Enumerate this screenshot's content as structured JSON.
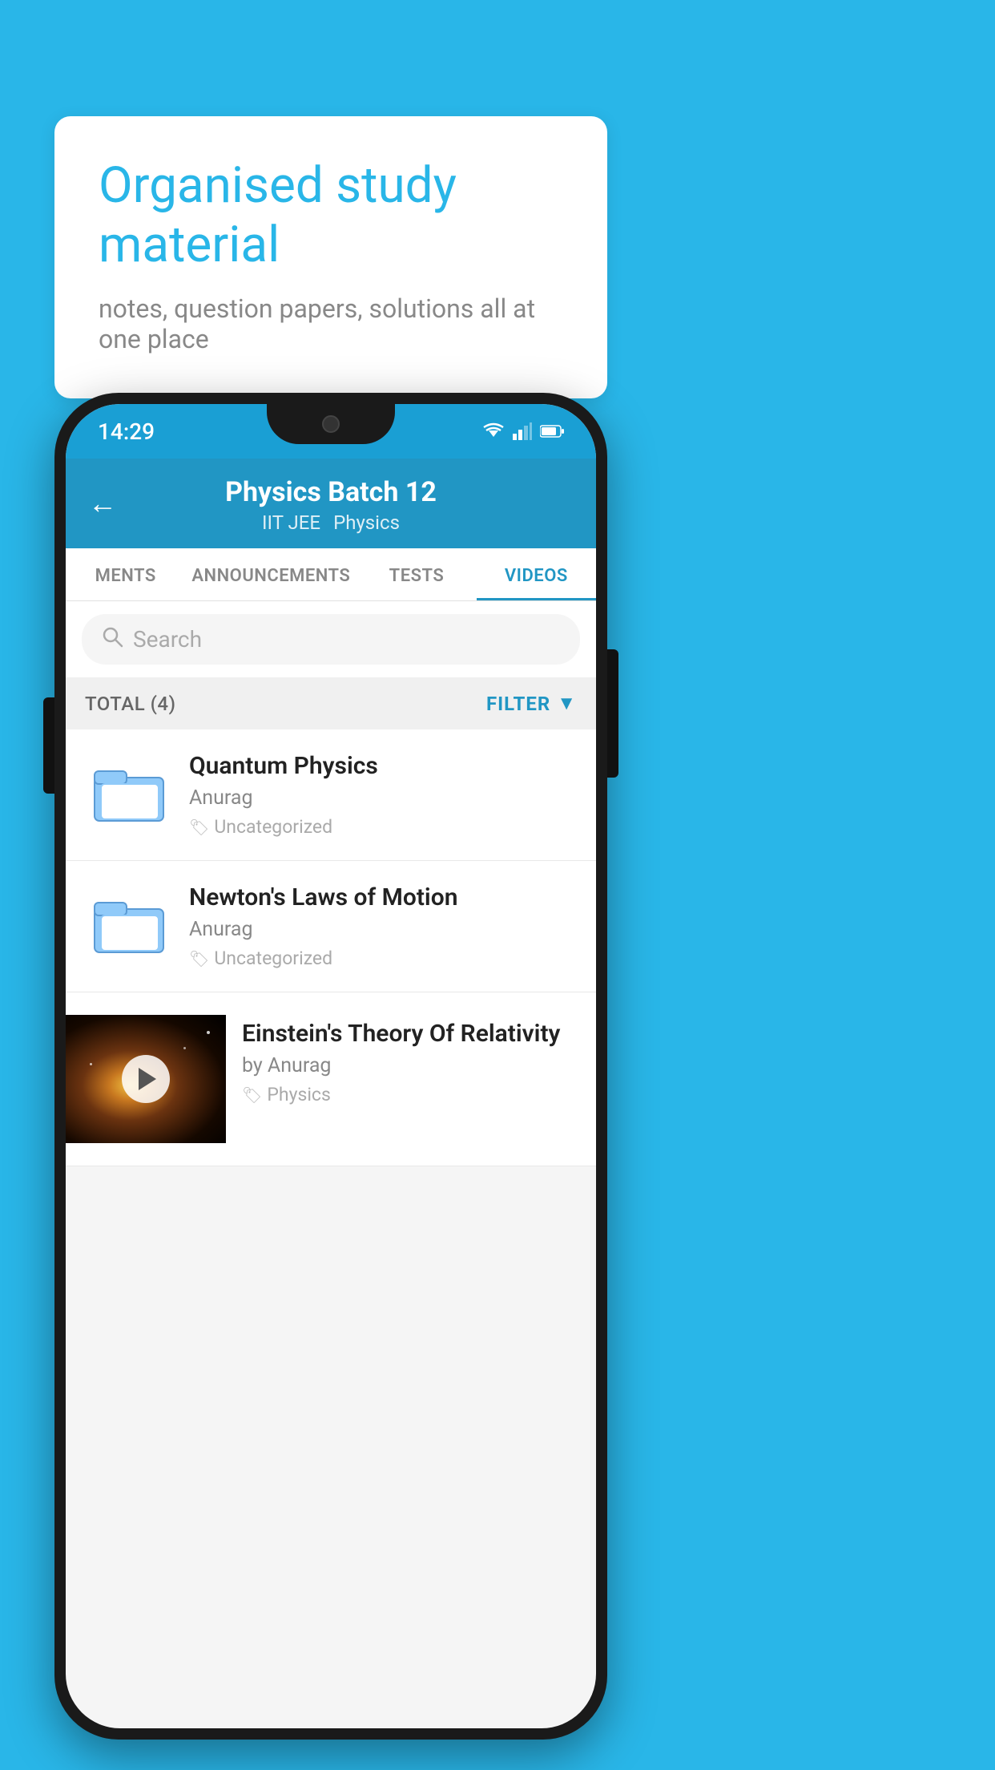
{
  "background_color": "#29b6e8",
  "speech_bubble": {
    "title": "Organised study material",
    "subtitle": "notes, question papers, solutions all at one place"
  },
  "phone": {
    "status_bar": {
      "time": "14:29"
    },
    "header": {
      "back_label": "←",
      "title": "Physics Batch 12",
      "subtitle_part1": "IIT JEE",
      "subtitle_part2": "Physics"
    },
    "tabs": [
      {
        "label": "MENTS",
        "active": false
      },
      {
        "label": "ANNOUNCEMENTS",
        "active": false
      },
      {
        "label": "TESTS",
        "active": false
      },
      {
        "label": "VIDEOS",
        "active": true
      }
    ],
    "search": {
      "placeholder": "Search"
    },
    "filter_bar": {
      "total_label": "TOTAL (4)",
      "filter_label": "FILTER"
    },
    "videos": [
      {
        "id": 1,
        "title": "Quantum Physics",
        "author": "Anurag",
        "tag": "Uncategorized",
        "type": "folder"
      },
      {
        "id": 2,
        "title": "Newton's Laws of Motion",
        "author": "Anurag",
        "tag": "Uncategorized",
        "type": "folder"
      },
      {
        "id": 3,
        "title": "Einstein's Theory Of Relativity",
        "author": "by Anurag",
        "tag": "Physics",
        "type": "video"
      }
    ]
  }
}
